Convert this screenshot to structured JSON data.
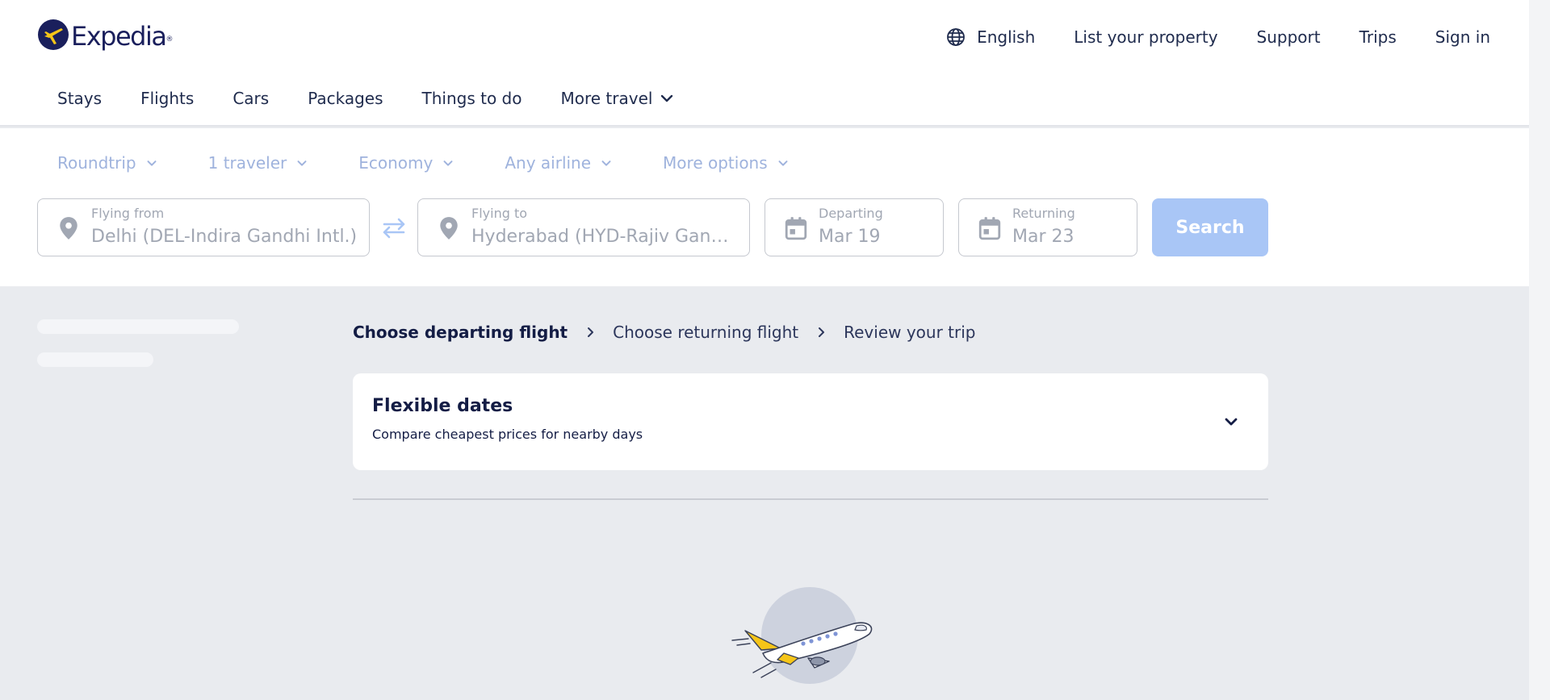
{
  "brand": {
    "name": "Expedia",
    "trademark": "®",
    "accent": "#1a1f5c",
    "logo_yellow": "#f5c518"
  },
  "topnav": {
    "language": "English",
    "list_property": "List your property",
    "support": "Support",
    "trips": "Trips",
    "sign_in": "Sign in"
  },
  "lob_tabs": [
    "Stays",
    "Flights",
    "Cars",
    "Packages",
    "Things to do",
    "More travel"
  ],
  "filters": {
    "trip_type": "Roundtrip",
    "travelers": "1 traveler",
    "cabin": "Economy",
    "airline": "Any airline",
    "more": "More options"
  },
  "search": {
    "from_label": "Flying from",
    "from_value": "Delhi (DEL-Indira Gandhi Intl.)",
    "to_label": "Flying to",
    "to_value": "Hyderabad (HYD-Rajiv Gandhi Intl.)",
    "depart_label": "Departing",
    "depart_value": "Mar 19",
    "return_label": "Returning",
    "return_value": "Mar 23",
    "button": "Search",
    "button_color": "#a9c6f6"
  },
  "breadcrumb": {
    "step1": "Choose departing flight",
    "step2": "Choose returning flight",
    "step3": "Review your trip"
  },
  "flexible_dates": {
    "title": "Flexible dates",
    "subtitle": "Compare cheapest prices for nearby days"
  },
  "icons": {
    "globe": "globe-icon",
    "chevron": "chevron-down-icon",
    "pin": "location-pin-icon",
    "swap": "swap-icon",
    "calendar": "calendar-icon",
    "plane": "airplane-illustration"
  }
}
